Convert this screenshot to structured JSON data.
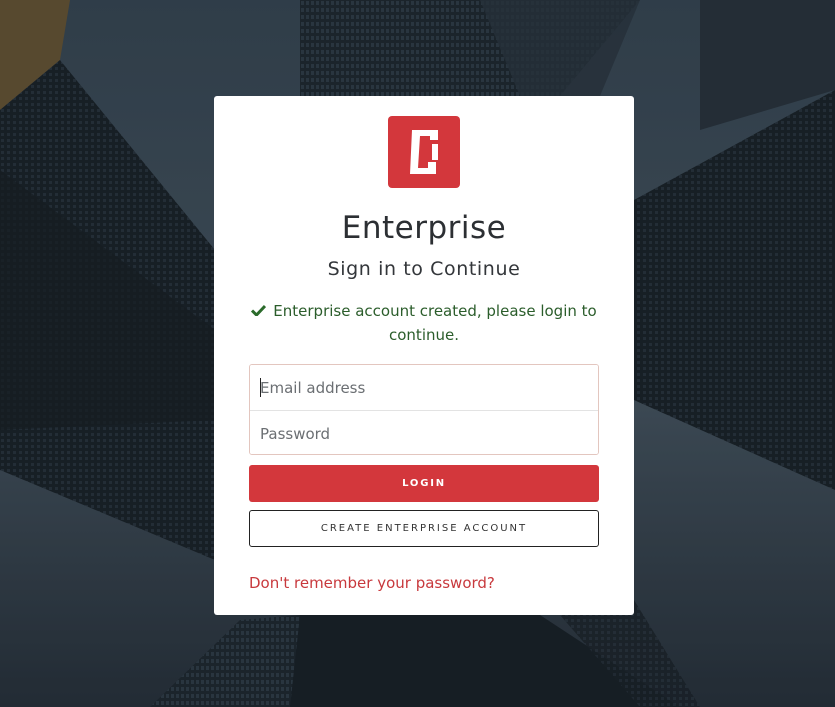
{
  "app": {
    "title": "Enterprise",
    "subtitle": "Sign in to Continue"
  },
  "notice": {
    "text": "Enterprise account created, please login to continue.",
    "icon": "check-icon",
    "color": "#2b5d2b"
  },
  "form": {
    "email": {
      "value": "",
      "placeholder": "Email address"
    },
    "password": {
      "value": "",
      "placeholder": "Password"
    }
  },
  "buttons": {
    "login_label": "LOGIN",
    "create_label": "CREATE ENTERPRISE ACCOUNT"
  },
  "links": {
    "forgot_password": "Don't remember your password?"
  },
  "colors": {
    "brand": "#d3373c",
    "link": "#c8393d"
  },
  "logo": {
    "icon": "brand-logo-c-icon"
  }
}
